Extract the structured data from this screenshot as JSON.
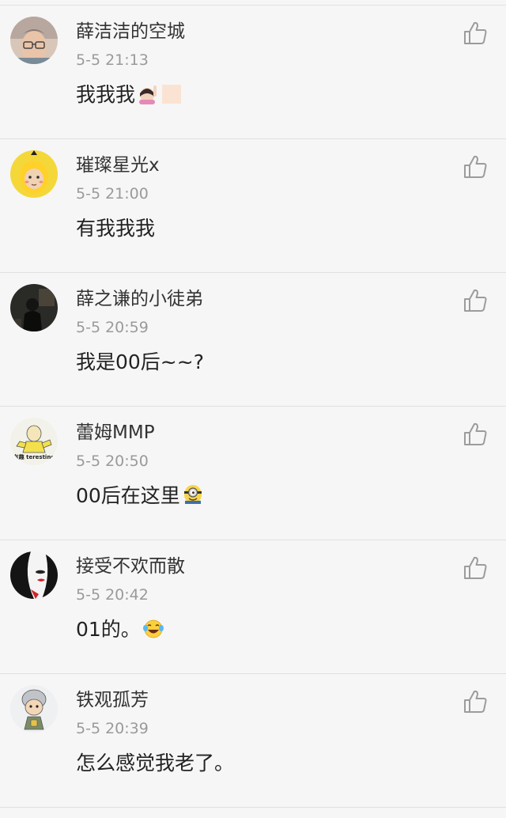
{
  "comments": [
    {
      "name": "薛洁洁的空城",
      "time": "5-5 21:13",
      "text": "我我我",
      "emoji": "woman-raising-hand-emoji"
    },
    {
      "name": "璀璨星光x",
      "time": "5-5 21:00",
      "text": "有我我我",
      "emoji": ""
    },
    {
      "name": "薛之谦的小徒弟",
      "time": "5-5 20:59",
      "text": "我是00后~~?",
      "emoji": ""
    },
    {
      "name": "蕾姆MMP",
      "time": "5-5 20:50",
      "text": "00后在这里",
      "emoji": "minion-emoji",
      "avatar_caption": "有趣\nteresting"
    },
    {
      "name": "接受不欢而散",
      "time": "5-5 20:42",
      "text": "01的。",
      "emoji": "laughing-tears-emoji"
    },
    {
      "name": "铁观孤芳",
      "time": "5-5 20:39",
      "text": "怎么感觉我老了。",
      "emoji": ""
    }
  ],
  "icons": {
    "like": "thumbs-up-outline-icon"
  },
  "colors": {
    "background": "#f6f6f6",
    "name_text": "#333333",
    "time_text": "#9a9a9a",
    "body_text": "#222222",
    "divider": "#e0e0e0",
    "like_icon": "#9c9c9c"
  }
}
